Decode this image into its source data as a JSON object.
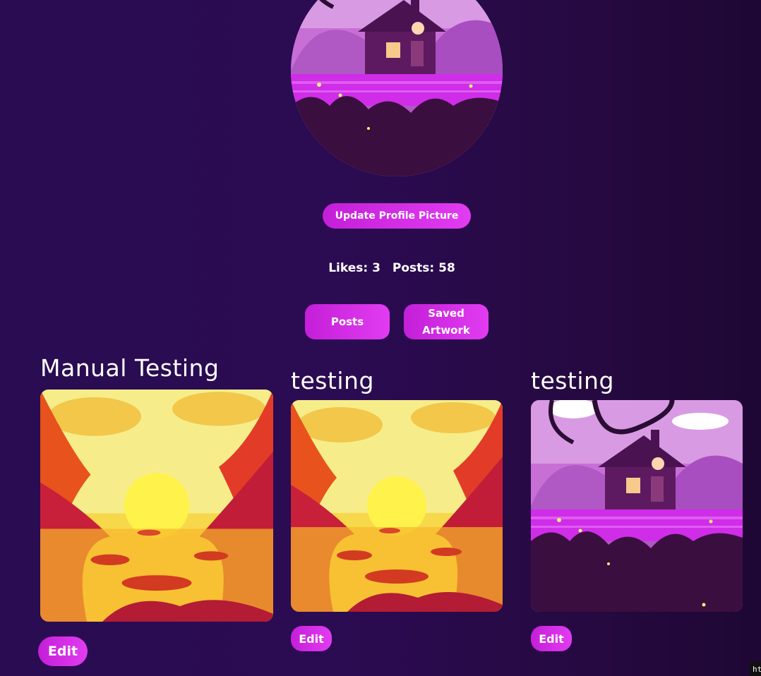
{
  "profile": {
    "update_picture_label": "Update Profile Picture",
    "likes_label": "Likes: 3",
    "posts_label": "Posts: 58"
  },
  "tabs": [
    {
      "label": "Posts"
    },
    {
      "label": "Saved\nArtwork"
    }
  ],
  "posts": [
    {
      "title": "Manual Testing",
      "image": "sunset-lake-artwork",
      "edit_label": "Edit"
    },
    {
      "title": "testing",
      "image": "sunset-lake-artwork",
      "edit_label": "Edit"
    },
    {
      "title": "testing",
      "image": "purple-cottage-artwork",
      "edit_label": "Edit"
    }
  ],
  "status_bar_text": "ht",
  "colors": {
    "background": "#2a0c52",
    "button": "#d62ee8",
    "text": "#ffffff"
  }
}
